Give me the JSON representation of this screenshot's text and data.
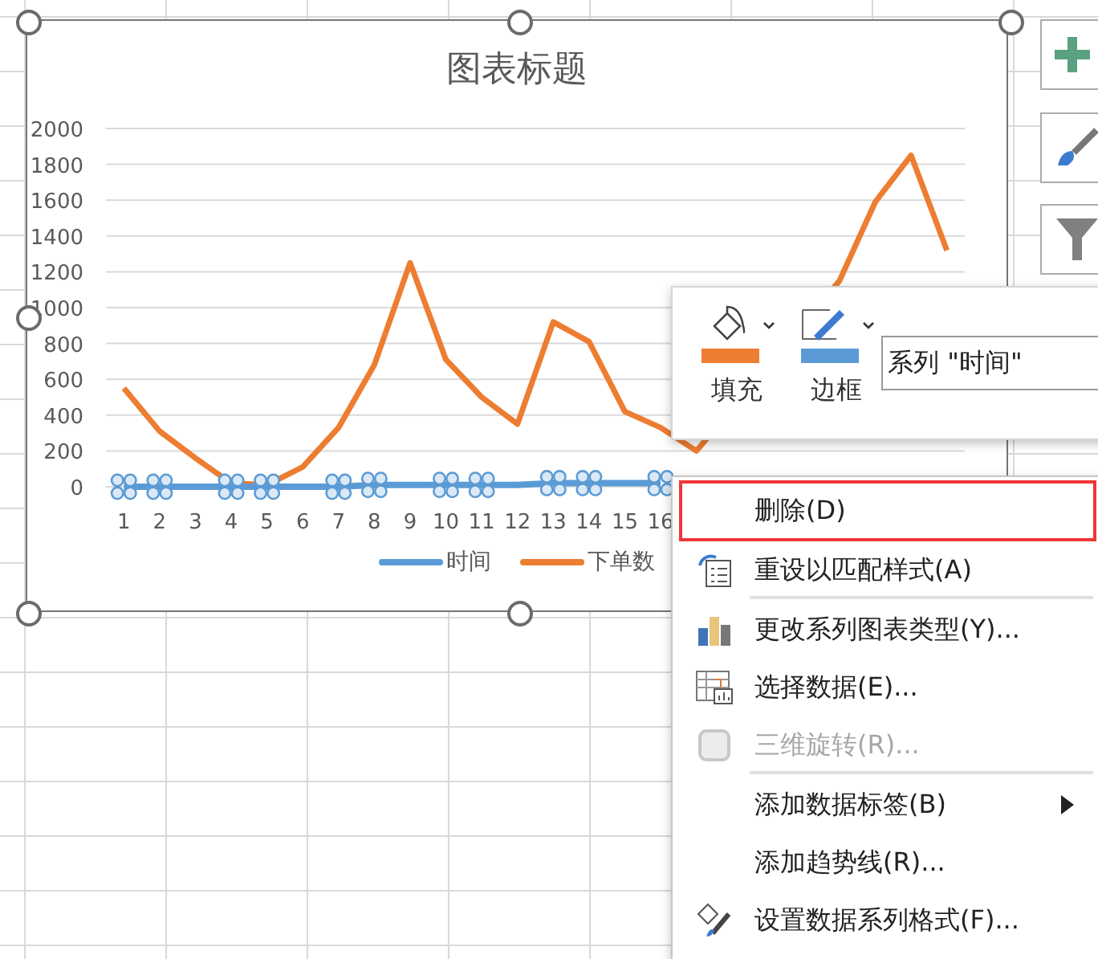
{
  "chart": {
    "title": "图表标题",
    "series_selection": [
      {
        "selected": true
      },
      {
        "selected": false
      }
    ],
    "chart_data": {
      "type": "line",
      "grid": true,
      "x": [
        1,
        2,
        3,
        4,
        5,
        6,
        7,
        8,
        9,
        10,
        11,
        12,
        13,
        14,
        15,
        16,
        17,
        21,
        22,
        23,
        24
      ],
      "xlim": [
        0.5,
        24.5
      ],
      "xticks": [
        1,
        2,
        3,
        4,
        5,
        6,
        7,
        8,
        9,
        10,
        11,
        12,
        13,
        14,
        15,
        16
      ],
      "ylim": [
        0,
        2000
      ],
      "yticks": [
        0,
        200,
        400,
        600,
        800,
        1000,
        1200,
        1400,
        1600,
        1800,
        2000
      ],
      "series": [
        {
          "name": "时间",
          "color": "#5b9bd5",
          "values": [
            0,
            0,
            0,
            0,
            0,
            0,
            0,
            10,
            10,
            10,
            10,
            10,
            20,
            20,
            20,
            20,
            null,
            null,
            null,
            null,
            null
          ]
        },
        {
          "name": "下单数",
          "color": "#ed7d31",
          "values": [
            550,
            310,
            160,
            20,
            10,
            110,
            330,
            680,
            1250,
            710,
            500,
            350,
            920,
            810,
            420,
            330,
            200,
            1150,
            1590,
            1850,
            1320
          ]
        }
      ]
    }
  },
  "mini_toolbar": {
    "buttons": [
      {
        "label": "填充",
        "color": "#ed7d31"
      },
      {
        "label": "边框",
        "color": "#5b9bd5"
      }
    ],
    "series_picker": {
      "value": "系列 \"时间\""
    }
  },
  "context_menu": {
    "items": [
      {
        "label": "删除(D)",
        "selected": true,
        "disabled": false,
        "separator_after": false,
        "submenu": false
      },
      {
        "label": "重设以匹配样式(A)",
        "selected": false,
        "disabled": false,
        "separator_after": true,
        "submenu": false
      },
      {
        "label": "更改系列图表类型(Y)...",
        "selected": false,
        "disabled": false,
        "separator_after": false,
        "submenu": false
      },
      {
        "label": "选择数据(E)...",
        "selected": false,
        "disabled": false,
        "separator_after": false,
        "submenu": false
      },
      {
        "label": "三维旋转(R)...",
        "selected": false,
        "disabled": true,
        "separator_after": true,
        "submenu": false
      },
      {
        "label": "添加数据标签(B)",
        "selected": false,
        "disabled": false,
        "separator_after": false,
        "submenu": true
      },
      {
        "label": "添加趋势线(R)...",
        "selected": false,
        "disabled": false,
        "separator_after": false,
        "submenu": false
      },
      {
        "label": "设置数据系列格式(F)...",
        "selected": false,
        "disabled": false,
        "separator_after": false,
        "submenu": false
      }
    ]
  }
}
